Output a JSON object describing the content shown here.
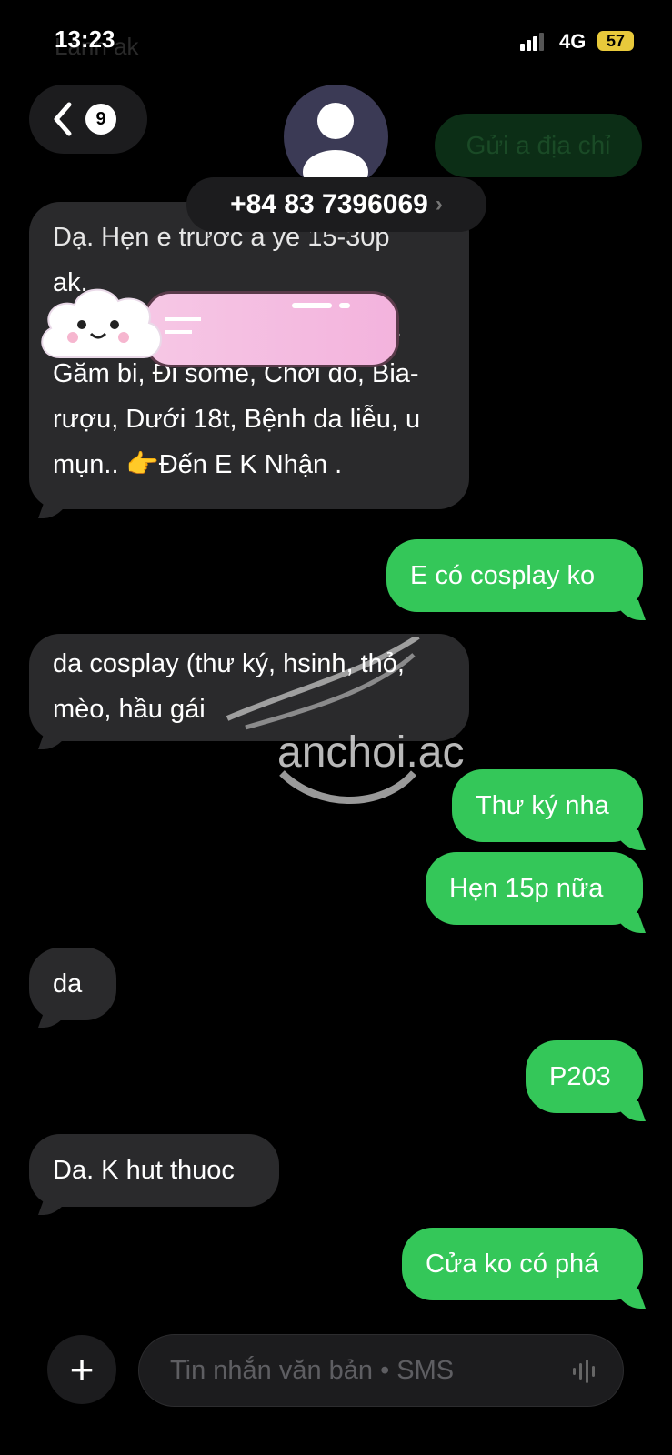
{
  "status_bar": {
    "time": "13:23",
    "network": "4G",
    "battery": "57",
    "ghost_text": "Lanh ak"
  },
  "header": {
    "back_count": "9",
    "phone_number": "+84 83 7396069"
  },
  "ghost_bubble": "Gửi a địa chỉ",
  "messages": [
    {
      "dir": "in",
      "text": "Dạ. Hẹn e trước a ye 15-30p ak.\n  h.\nGăm bi, Đi some, Chơi đồ, Bia-rượu, Dưới 18t, Bệnh da liễu, u mụn.. 👉Đến E K Nhận ."
    },
    {
      "dir": "out",
      "text": "E có cosplay ko"
    },
    {
      "dir": "in",
      "text": "da cosplay (thư ký, hsinh, thỏ, mèo, hầu gái"
    },
    {
      "dir": "out",
      "text": "Thư ký nha"
    },
    {
      "dir": "out",
      "text": "Hẹn 15p nữa"
    },
    {
      "dir": "in",
      "text": "da"
    },
    {
      "dir": "out",
      "text": "P203"
    },
    {
      "dir": "in",
      "text": "Da. K hut thuoc"
    },
    {
      "dir": "out",
      "text": "Cửa ko có phá"
    }
  ],
  "composer": {
    "placeholder": "Tin nhắn văn bản • SMS"
  },
  "watermark": "anchoi.ac",
  "colors": {
    "outgoing": "#34c759",
    "incoming": "#2a2a2c",
    "background": "#000000"
  }
}
